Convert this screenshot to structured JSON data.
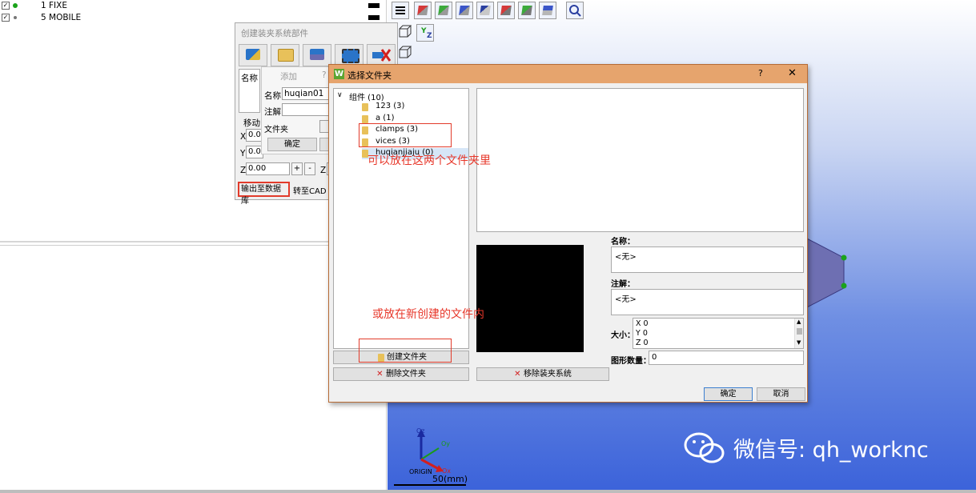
{
  "tree": {
    "items": [
      {
        "text": "1  FIXE",
        "dot_color": "#1aa31a"
      },
      {
        "text": "5  MOBILE",
        "dot_color": "#777777"
      }
    ]
  },
  "fixture_panel": {
    "title": "创建装夹系统部件",
    "name_label": "名称",
    "move_label": "移动",
    "x_label": "X",
    "x_value": "0.00",
    "y_label": "Y",
    "y_value": "0.00",
    "z_label": "Z",
    "z_value": "0.00",
    "plus": "+",
    "minus": "-",
    "z_label2": "Z",
    "export_db_button": "输出至数据库",
    "to_cad_button": "转至CAD",
    "add_popup": {
      "title": "添加",
      "help": "?",
      "name_label": "名称",
      "name_value": "huqian01",
      "note_label": "注解",
      "folder_label": "文件夹",
      "ok_button": "确定"
    }
  },
  "dialog": {
    "icon_letter": "W",
    "title": "选择文件夹",
    "help": "?",
    "close": "✕",
    "folders_root": "组件 (10)",
    "folders": [
      "123 (3)",
      "a (1)",
      "clamps (3)",
      "vices (3)",
      "huqianjiaju (0)"
    ],
    "create_folder_button": "创建文件夹",
    "delete_folder_button": "删除文件夹",
    "remove_fixture_button": "移除装夹系统",
    "name_label": "名称：",
    "name_value": "<无>",
    "note_label": "注解：",
    "note_value": "<无>",
    "size_label": "大小：",
    "size_lines": [
      "X 0",
      "Y 0",
      "Z 0"
    ],
    "shape_count_label": "图形数量：",
    "shape_count_value": "0",
    "ok_button": "确定",
    "cancel_button": "取消"
  },
  "annotations": {
    "note1": "可以放在这两个文件夹里",
    "note2": "或放在新创建的文件内"
  },
  "viewport": {
    "axis_x_label": "Ox",
    "axis_y_label": "Oy",
    "axis_z_label": "Oz",
    "origin_label": "ORIGIN",
    "scale_label": "50(mm)",
    "mini_axis_y": "Y",
    "mini_axis_z": "Z"
  },
  "watermark": {
    "text": "微信号: qh_worknc"
  },
  "colors": {
    "dialog_title_bg": "#e6a46d",
    "annotation_red": "#e7372a",
    "viewport_bottom": "#3c63da"
  }
}
